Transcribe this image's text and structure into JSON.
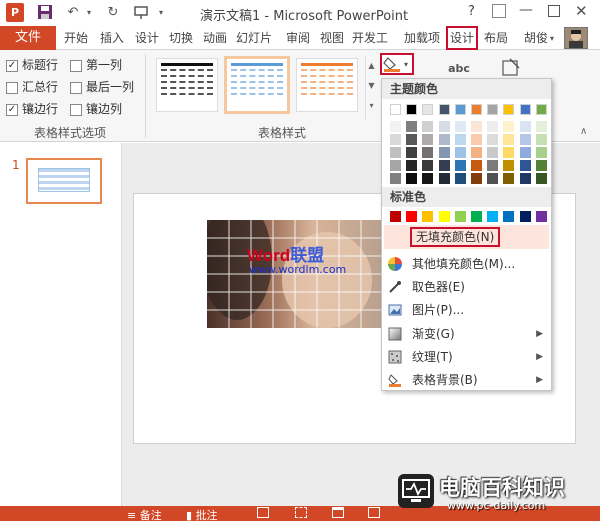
{
  "window": {
    "title": "演示文稿1 - Microsoft PowerPoint",
    "help": "?",
    "user": "胡俊"
  },
  "tabs": {
    "file": "文件",
    "items": [
      "开始",
      "插入",
      "设计",
      "切换",
      "动画",
      "幻灯片",
      "审阅",
      "视图",
      "开发工",
      "加载项",
      "设计",
      "布局"
    ]
  },
  "table_style_options": {
    "group_label": "表格样式选项",
    "options": [
      {
        "label": "标题行",
        "checked": true
      },
      {
        "label": "第一列",
        "checked": false
      },
      {
        "label": "汇总行",
        "checked": false
      },
      {
        "label": "最后一列",
        "checked": false
      },
      {
        "label": "镶边行",
        "checked": true
      },
      {
        "label": "镶边列",
        "checked": false
      }
    ]
  },
  "table_styles": {
    "group_label": "表格样式",
    "styles": [
      {
        "color": "#111111"
      },
      {
        "color": "#5b9bd5"
      },
      {
        "color": "#ed7d31"
      }
    ]
  },
  "art_button": "abc",
  "slide_number": "1",
  "slide_image_text": {
    "word": "Word",
    "brand": "联盟",
    "url": "www.wordlm.com"
  },
  "dropdown": {
    "theme_header": "主题颜色",
    "standard_header": "标准色",
    "theme_top": [
      "#ffffff",
      "#000000",
      "#e7e6e6",
      "#44546a",
      "#5b9bd5",
      "#ed7d31",
      "#a5a5a5",
      "#ffc000",
      "#4472c4",
      "#70ad47"
    ],
    "theme_columns": [
      [
        "#f2f2f2",
        "#d9d9d9",
        "#bfbfbf",
        "#a6a6a6",
        "#808080"
      ],
      [
        "#7f7f7f",
        "#595959",
        "#404040",
        "#262626",
        "#0d0d0d"
      ],
      [
        "#d0cece",
        "#aeaaaa",
        "#757171",
        "#3a3838",
        "#171616"
      ],
      [
        "#d6dce4",
        "#adb9ca",
        "#8497b0",
        "#333f50",
        "#222a35"
      ],
      [
        "#deebf6",
        "#bdd7ee",
        "#9dc3e6",
        "#2e75b5",
        "#1f4e79"
      ],
      [
        "#fbe5d5",
        "#f7cbac",
        "#f4b183",
        "#c55a11",
        "#833c0b"
      ],
      [
        "#ededed",
        "#dbdbdb",
        "#c9c9c9",
        "#7b7b7b",
        "#525252"
      ],
      [
        "#fff2cc",
        "#fee599",
        "#ffd965",
        "#bf9000",
        "#7f6000"
      ],
      [
        "#dae3f3",
        "#b4c7e7",
        "#8faadc",
        "#2f5597",
        "#203864"
      ],
      [
        "#e2efd9",
        "#c5e0b3",
        "#a8d08d",
        "#538135",
        "#375623"
      ]
    ],
    "standard": [
      "#c00000",
      "#ff0000",
      "#ffc000",
      "#ffff00",
      "#92d050",
      "#00b050",
      "#00b0f0",
      "#0070c0",
      "#002060",
      "#7030a0"
    ],
    "no_fill": "无填充颜色(N)",
    "items": [
      {
        "label": "其他填充颜色(M)...",
        "icon": "color-wheel-icon",
        "submenu": false
      },
      {
        "label": "取色器(E)",
        "icon": "eyedropper-icon",
        "submenu": false
      },
      {
        "label": "图片(P)...",
        "icon": "picture-icon",
        "submenu": false
      },
      {
        "label": "渐变(G)",
        "icon": "gradient-icon",
        "submenu": true
      },
      {
        "label": "纹理(T)",
        "icon": "texture-icon",
        "submenu": true
      },
      {
        "label": "表格背景(B)",
        "icon": "table-background-icon",
        "submenu": true
      }
    ]
  },
  "statusbar": {
    "notes": "备注",
    "comments": "批注"
  },
  "watermark": {
    "title": "电脑百科知识",
    "url": "www.pc-daily.com"
  }
}
